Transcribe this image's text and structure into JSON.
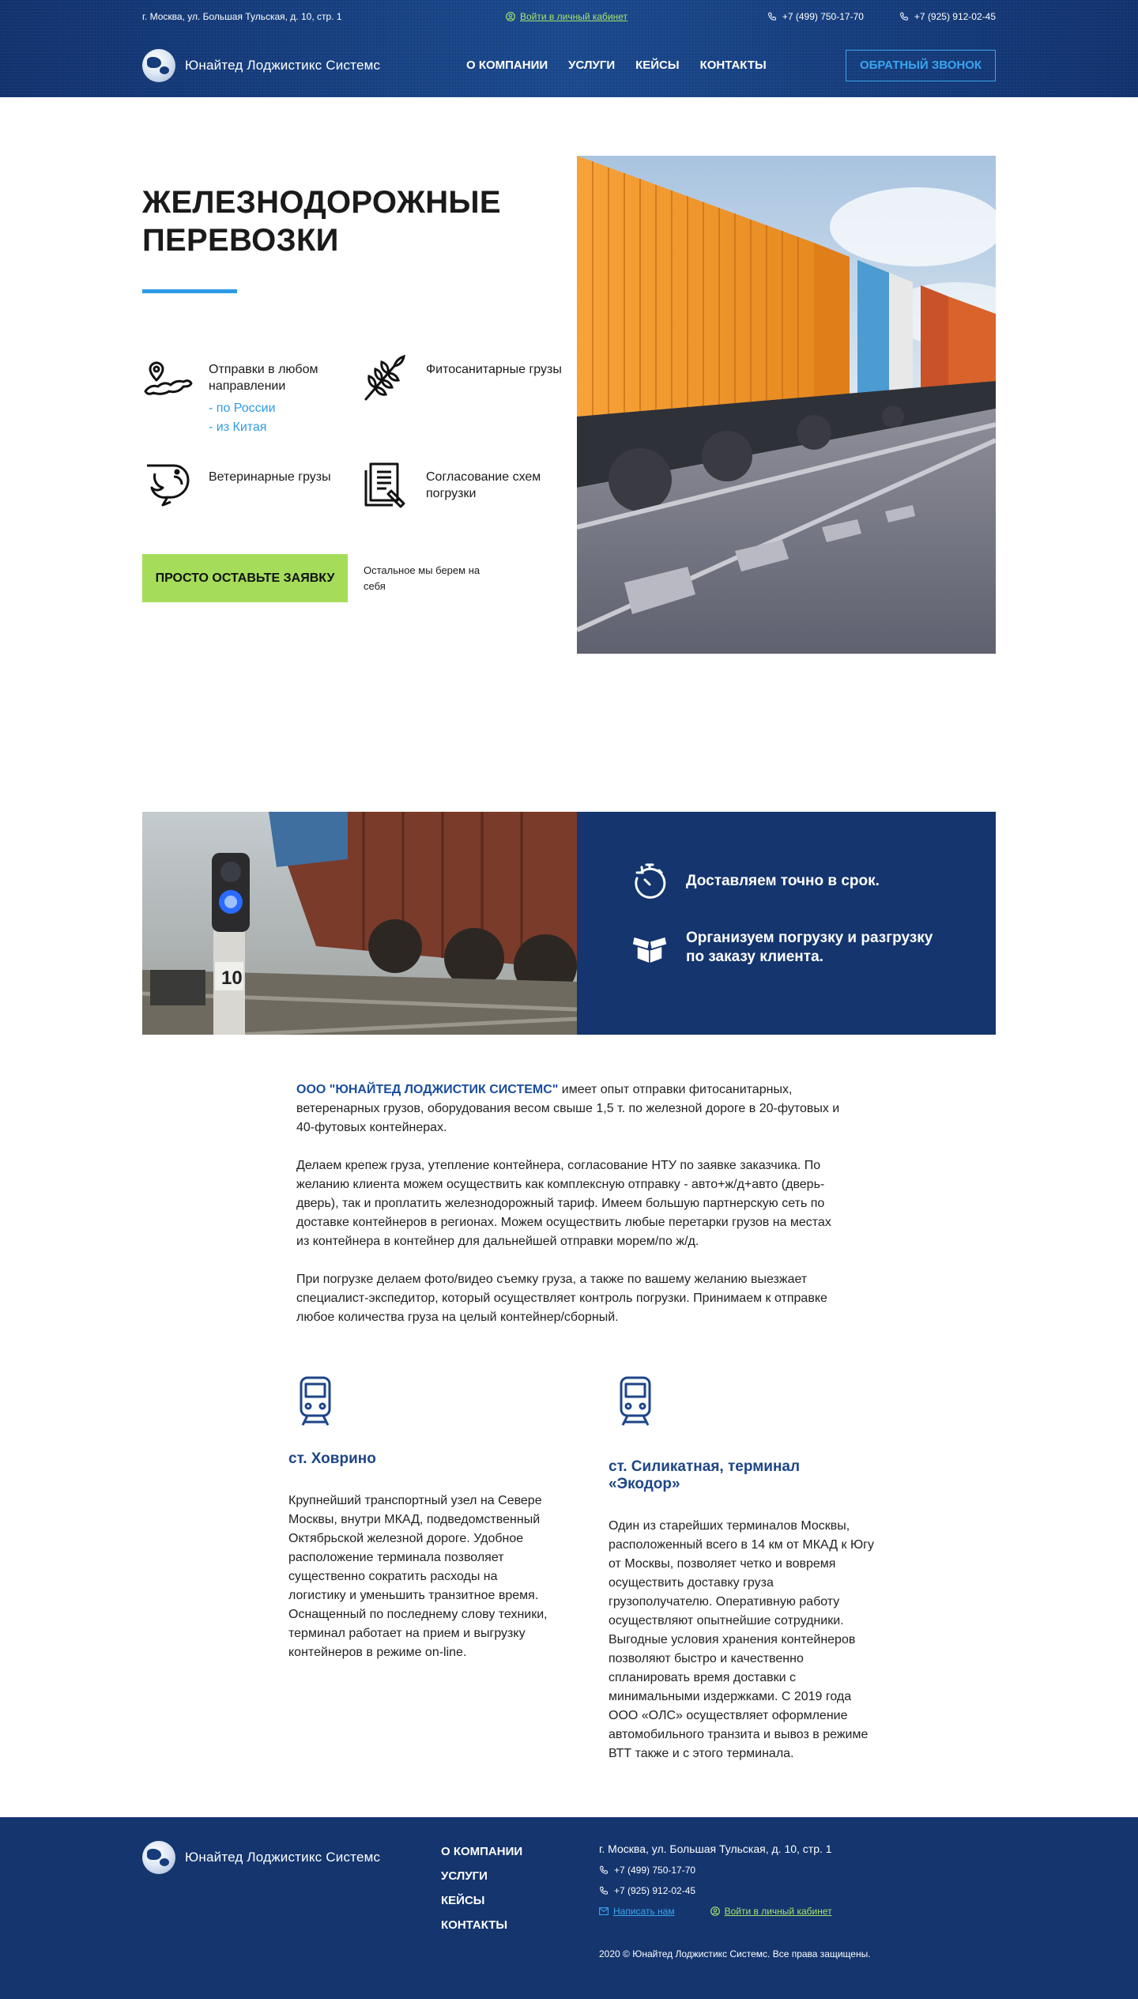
{
  "header": {
    "address": "г. Москва, ул. Большая Тульская, д. 10, стр. 1",
    "cabinet_link": "Войти в личный кабинет",
    "phone1": "+7 (499) 750-17-70",
    "phone2": "+7 (925) 912-02-45",
    "logo_text": "Юнайтед Лоджистикс Системс",
    "menu": [
      "О КОМПАНИИ",
      "УСЛУГИ",
      "КЕЙСЫ",
      "КОНТАКТЫ"
    ],
    "callback_label": "ОБРАТНЫЙ ЗВОНОК"
  },
  "hero": {
    "title": "ЖЕЛЕЗНОДОРОЖНЫЕ ПЕРЕВОЗКИ",
    "features": [
      {
        "text": "Отправки в любом направлении",
        "icon": "map-pin-icon",
        "sub1": "- по России",
        "sub2": "- из Китая"
      },
      {
        "text": "Фитосанитарные грузы",
        "icon": "wheat-icon"
      },
      {
        "text": "Ветеринарные грузы",
        "icon": "shrimp-icon"
      },
      {
        "text": "Согласование схем погрузки",
        "icon": "documents-icon"
      }
    ],
    "cta_label": "ПРОСТО ОСТАВЬТЕ ЗАЯВКУ",
    "cta_note": "Остальное мы берем на себя"
  },
  "banner": {
    "adv1": "Доставляем точно в срок.",
    "adv2": "Организуем погрузку и разгрузку по заказу клиента.",
    "signal_number": "10"
  },
  "description": {
    "company": "ООО \"ЮНАЙТЕД ЛОДЖИСТИК СИСТЕМС\"",
    "p1_rest": " имеет опыт отправки фитосанитарных, ветеренарных грузов, оборудования весом свыше 1,5 т. по железной дороге в 20-футовых и 40-футовых контейнерах.",
    "p2": "Делаем крепеж груза, утепление контейнера, согласование НТУ по заявке заказчика. По желанию клиента можем осуществить как комплексную отправку - авто+ж/д+авто (дверь-дверь), так и проплатить железнодорожный тариф. Имеем большую партнерскую сеть по доставке контейнеров в регионах. Можем осуществить любые перетарки грузов на местах из контейнера в контейнер для дальнейшей отправки морем/по ж/д.",
    "p3": "При погрузке делаем фото/видео съемку груза, а также по вашему желанию выезжает специалист-экспедитор, который осуществляет контроль погрузки. Принимаем к отправке любое количества груза на целый контейнер/сборный."
  },
  "terminals": [
    {
      "title": "ст. Ховрино",
      "text": "Крупнейший транспортный узел на Севере Москвы, внутри МКАД, подведомственный Октябрьской железной дороге. Удобное расположение терминала позволяет существенно сократить расходы на логистику и уменьшить транзитное время. Оснащенный по последнему слову техники, терминал работает на прием и выгрузку контейнеров в режиме on-line."
    },
    {
      "title": "ст. Силикатная, терминал «Экодор»",
      "text": "Один из старейших терминалов Москвы, расположенный всего в 14 км от МКАД к Югу от Москвы, позволяет четко и вовремя осуществить доставку груза грузополучателю. Оперативную работу осуществляют опытнейшие сотрудники. Выгодные условия хранения контейнеров позволяют быстро и качественно спланировать время доставки с минимальными издержками. С 2019 года ООО «ОЛС» осуществляет оформление автомобильного транзита и вывоз в режиме ВТТ также и с этого терминала."
    }
  ],
  "footer": {
    "logo_text": "Юнайтед Лоджистикс Системс",
    "menu": [
      "О КОМПАНИИ",
      "УСЛУГИ",
      "КЕЙСЫ",
      "КОНТАКТЫ"
    ],
    "address": "г. Москва, ул. Большая Тульская, д. 10, стр. 1",
    "phone1": "+7 (499) 750-17-70",
    "phone2": "+7 (925) 912-02-45",
    "mail_link": "Написать нам",
    "cabinet_link": "Войти в личный кабинет",
    "copyright": "2020 © Юнайтед Лоджистикс Системс. Все права защищены."
  },
  "colors": {
    "brand_blue": "#14356e",
    "accent_blue": "#2e9be4",
    "accent_green": "#a5dd5b"
  }
}
